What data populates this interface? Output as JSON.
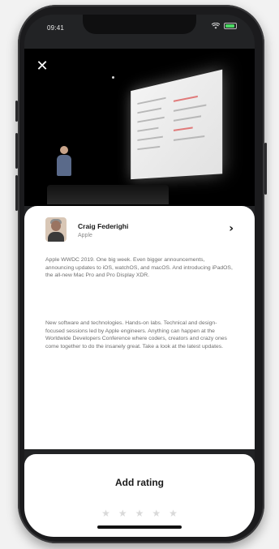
{
  "status_bar": {
    "time": "09:41"
  },
  "video": {
    "close_icon": "close-icon"
  },
  "speaker": {
    "name": "Craig Federighi",
    "org": "Apple",
    "chevron": "›"
  },
  "description": [
    "Apple WWDC 2019. One big week. Even bigger announcements, announcing updates to iOS, watchOS, and macOS. And introducing iPadOS, the all-new Mac Pro and Pro Display XDR.",
    "New software and technologies. Hands-on labs. Technical and design-focused sessions led by Apple engineers. Anything can happen at the Worldwide Developers Conference where coders, creators and crazy ones come together to do the insanely great. Take a look at the latest updates."
  ],
  "rating": {
    "label": "Add rating",
    "star_glyph": "★",
    "stars": 5
  },
  "colors": {
    "battery": "#4cd964",
    "card_bg": "#ffffff",
    "video_bg": "#000000"
  }
}
